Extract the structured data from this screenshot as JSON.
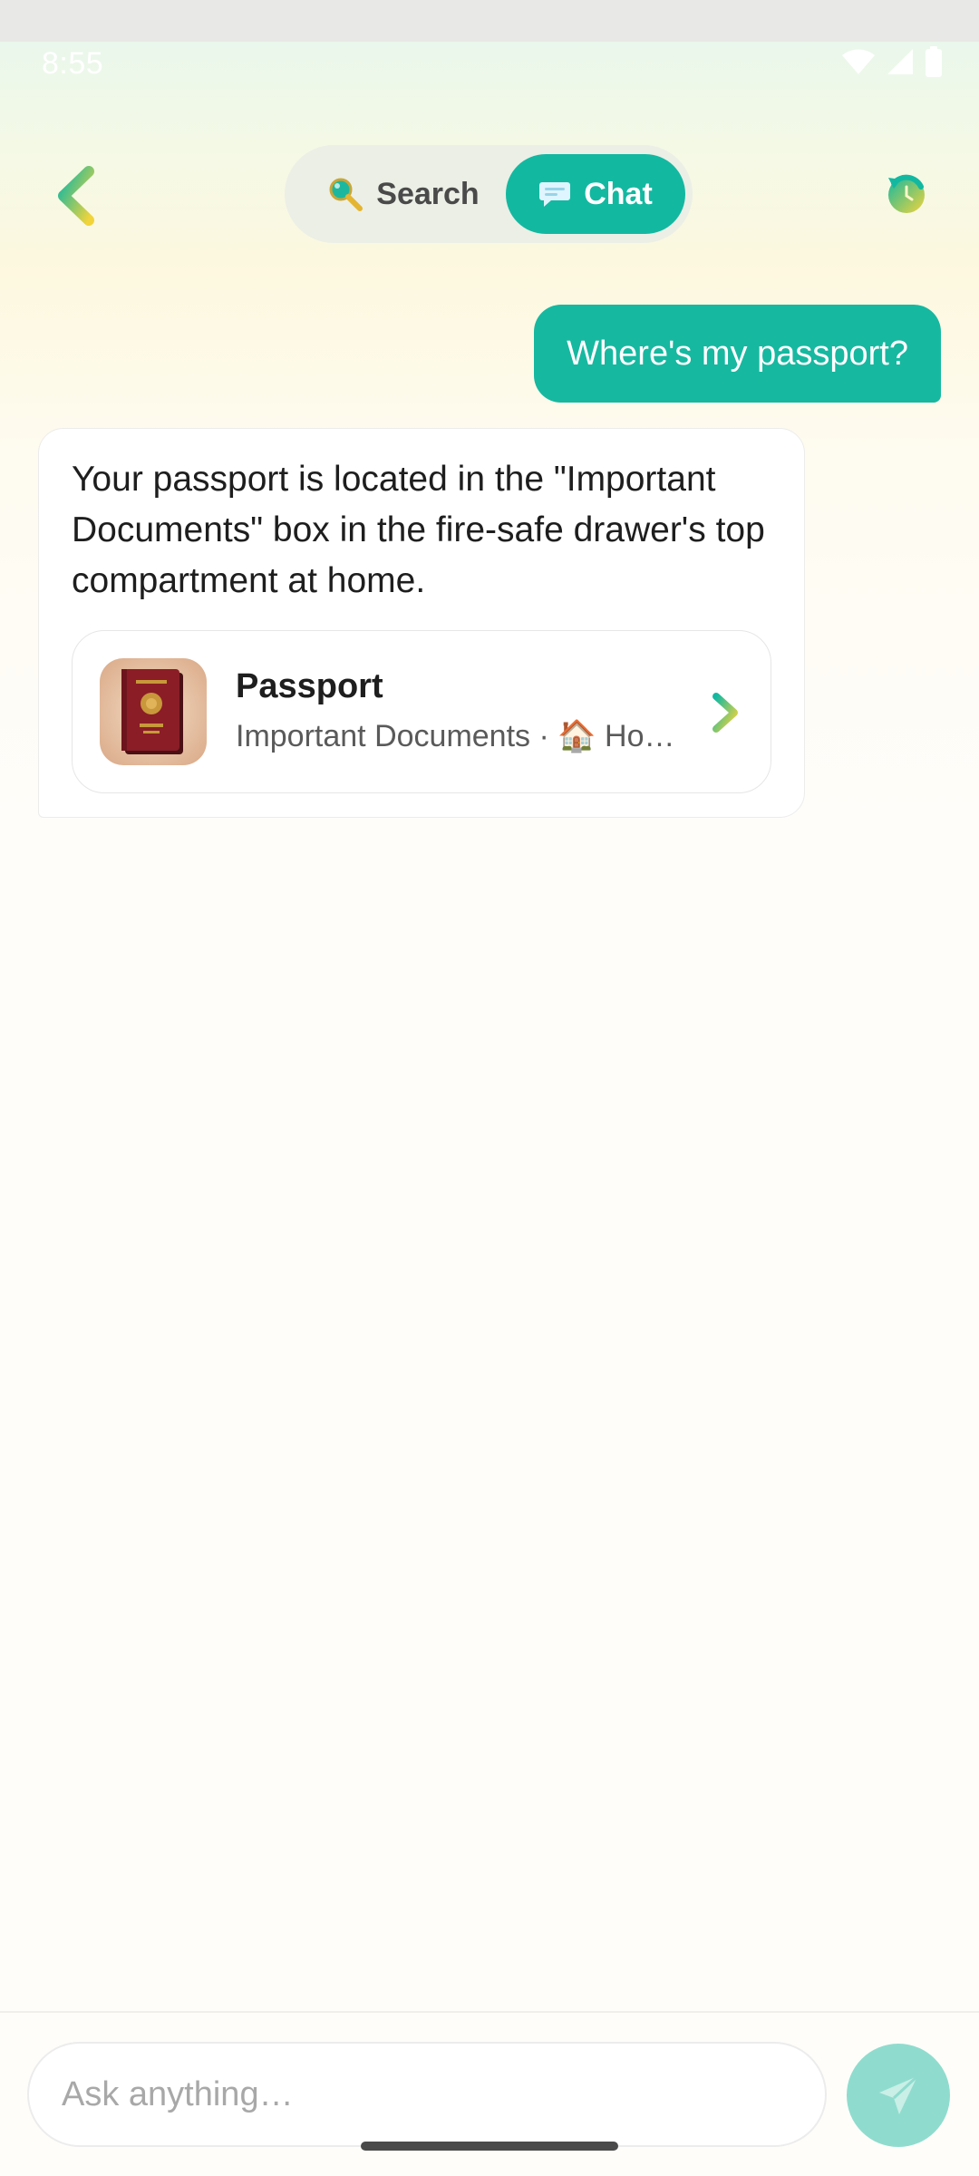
{
  "status_bar": {
    "time": "8:55",
    "icons": [
      "wifi-icon",
      "cellular-signal-icon",
      "battery-icon"
    ]
  },
  "header": {
    "back_icon": "chevron-left-icon",
    "mode_toggle": {
      "search": {
        "label": "Search",
        "icon": "magnifier-icon",
        "selected": false
      },
      "chat": {
        "label": "Chat",
        "icon": "speech-bubble-icon",
        "selected": true
      }
    },
    "refresh_icon": "refresh-icon"
  },
  "conversation": {
    "user_message": "Where's my passport?",
    "assistant_message": "Your passport is located in the \"Important Documents\" box in the fire-safe drawer's top compartment at home.",
    "item_card": {
      "title": "Passport",
      "subtitle": "Important Documents · 🏠 Home",
      "thumbnail": "passport-photo",
      "chevron_icon": "chevron-right-icon"
    }
  },
  "composer": {
    "placeholder": "Ask anything…",
    "send_icon": "send-plane-icon"
  },
  "colors": {
    "accent": "#13b8a1",
    "send_button_disabled": "#8fdcce",
    "yellow_accent": "#f2d43a"
  }
}
